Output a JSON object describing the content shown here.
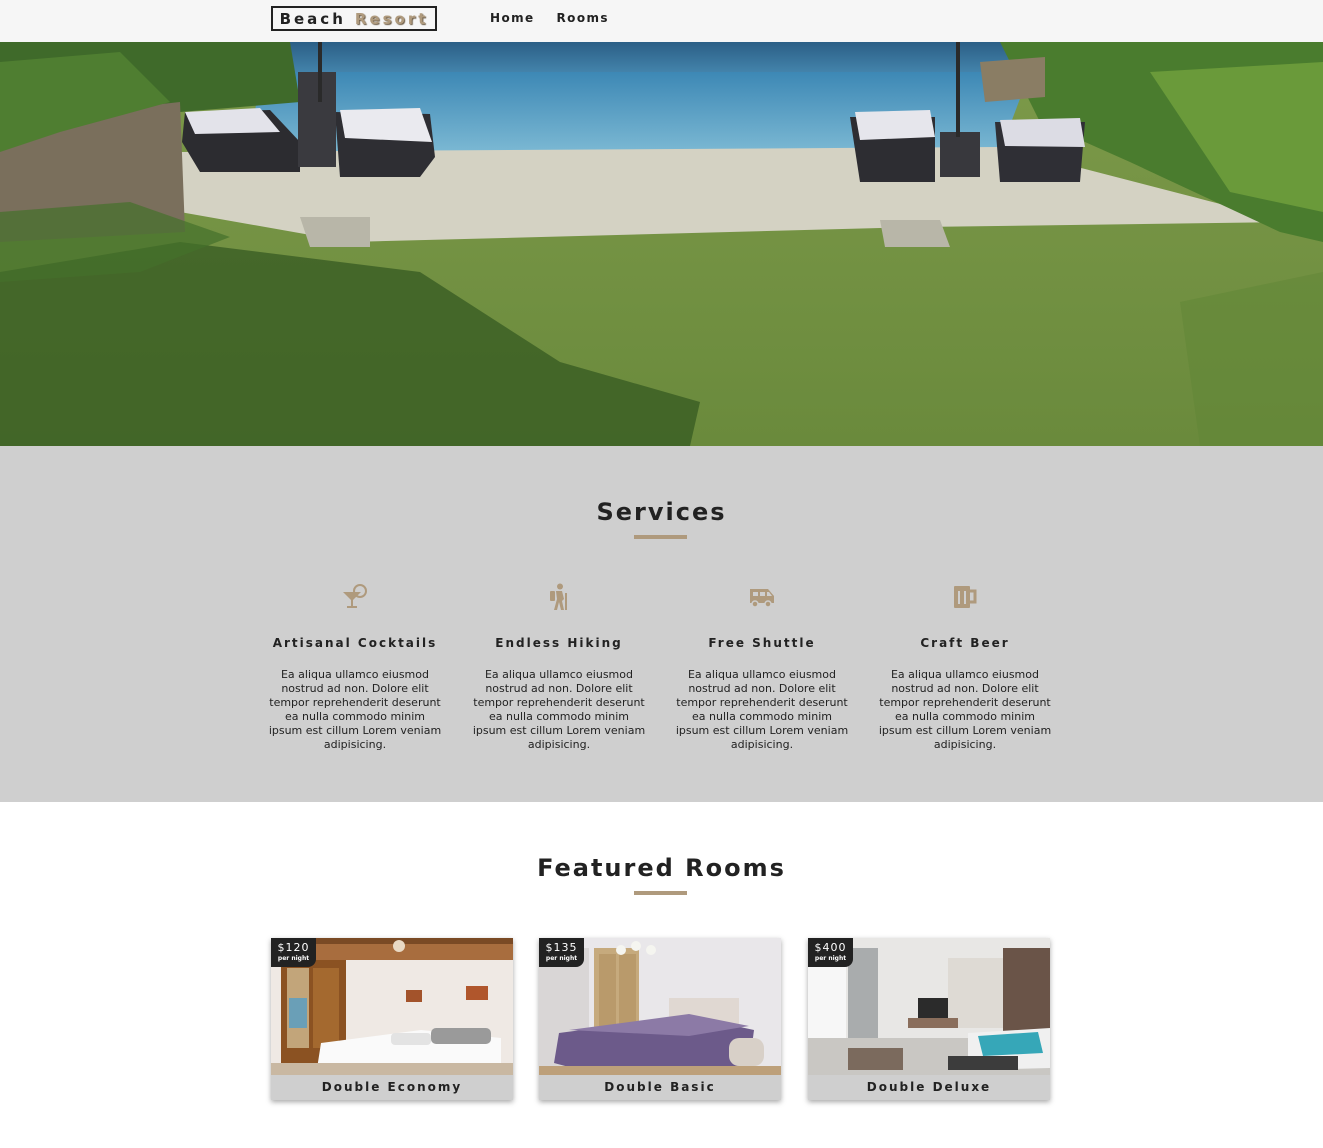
{
  "nav": {
    "logo_word1": "Beach",
    "logo_word2": "Resort",
    "links": [
      {
        "label": "Home"
      },
      {
        "label": "Rooms"
      }
    ]
  },
  "services": {
    "title": "Services",
    "items": [
      {
        "icon": "cocktail-icon",
        "title": "Artisanal Cocktails",
        "text": "Ea aliqua ullamco eiusmod nostrud ad non. Dolore elit tempor reprehenderit deserunt ea nulla commodo minim ipsum est cillum Lorem veniam adipisicing."
      },
      {
        "icon": "hiking-icon",
        "title": "Endless Hiking",
        "text": "Ea aliqua ullamco eiusmod nostrud ad non. Dolore elit tempor reprehenderit deserunt ea nulla commodo minim ipsum est cillum Lorem veniam adipisicing."
      },
      {
        "icon": "shuttle-van-icon",
        "title": "Free Shuttle",
        "text": "Ea aliqua ullamco eiusmod nostrud ad non. Dolore elit tempor reprehenderit deserunt ea nulla commodo minim ipsum est cillum Lorem veniam adipisicing."
      },
      {
        "icon": "beer-mug-icon",
        "title": "Craft Beer",
        "text": "Ea aliqua ullamco eiusmod nostrud ad non. Dolore elit tempor reprehenderit deserunt ea nulla commodo minim ipsum est cillum Lorem veniam adipisicing."
      }
    ]
  },
  "featured": {
    "title": "Featured Rooms",
    "rooms": [
      {
        "price": "$120",
        "per_night": "per night",
        "name": "Double Economy"
      },
      {
        "price": "$135",
        "per_night": "per night",
        "name": "Double Basic"
      },
      {
        "price": "$400",
        "per_night": "per night",
        "name": "Double Deluxe"
      }
    ]
  },
  "colors": {
    "accent": "#af9a7d",
    "dark": "#222222",
    "services_bg": "#cfcfcf",
    "nav_bg": "#f6f6f6"
  }
}
